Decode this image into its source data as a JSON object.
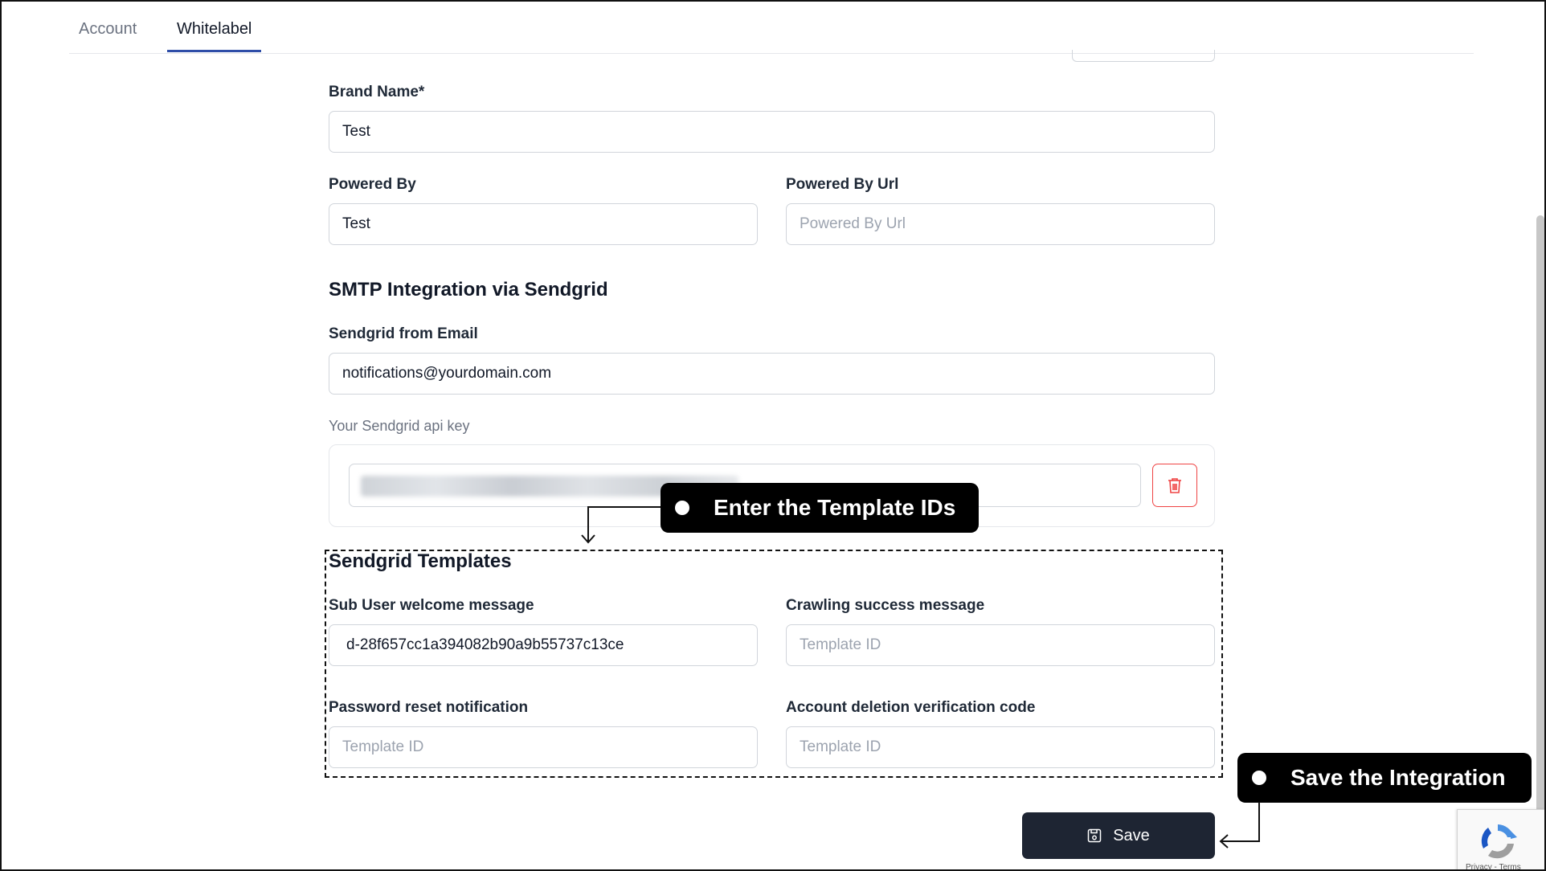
{
  "tabs": [
    {
      "label": "Account",
      "active": false
    },
    {
      "label": "Whitelabel",
      "active": true
    }
  ],
  "brand": {
    "label": "Brand Name*",
    "value": "Test"
  },
  "powered_by": {
    "label": "Powered By",
    "value": "Test"
  },
  "powered_by_url": {
    "label": "Powered By Url",
    "value": "",
    "placeholder": "Powered By Url"
  },
  "smtp": {
    "title": "SMTP Integration via Sendgrid",
    "from_email_label": "Sendgrid from Email",
    "from_email_value": "notifications@yourdomain.com",
    "api_key_label": "Your Sendgrid api key"
  },
  "templates": {
    "title": "Sendgrid Templates",
    "sub_user_label": "Sub User welcome message",
    "sub_user_value": "d-28f657cc1a394082b90a9b55737c13ce",
    "crawling_label": "Crawling success message",
    "password_label": "Password reset notification",
    "deletion_label": "Account deletion verification code",
    "placeholder": "Template ID"
  },
  "callouts": {
    "template_ids": "Enter the Template IDs",
    "save_integration": "Save the Integration"
  },
  "save_button": {
    "label": "Save"
  },
  "recaptcha": {
    "footer": "Privacy - Terms"
  },
  "colors": {
    "accent": "#2f4ea8",
    "save_bg": "#1e2533",
    "danger": "#ef4444",
    "callout_bg": "#000000"
  },
  "icons": [
    "trash-icon",
    "save-icon",
    "recaptcha-icon"
  ]
}
